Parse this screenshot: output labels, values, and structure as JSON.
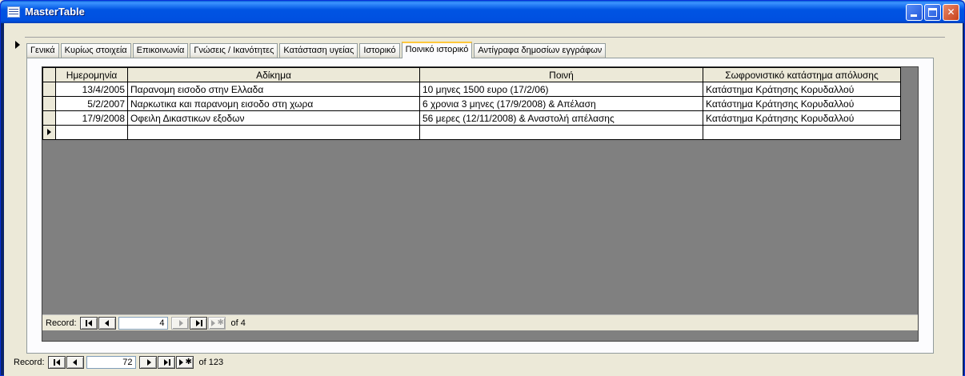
{
  "window": {
    "title": "MasterTable"
  },
  "tabs": [
    {
      "label": "Γενικά",
      "active": false
    },
    {
      "label": "Κυρίως στοιχεία",
      "active": false
    },
    {
      "label": "Επικοινωνία",
      "active": false
    },
    {
      "label": "Γνώσεις / Ικανότητες",
      "active": false
    },
    {
      "label": "Κατάσταση υγείας",
      "active": false
    },
    {
      "label": "Ιστορικό",
      "active": false
    },
    {
      "label": "Ποινικό ιστορικό",
      "active": true
    },
    {
      "label": "Αντίγραφα δημοσίων εγγράφων",
      "active": false
    }
  ],
  "grid": {
    "columns": [
      "Ημερομηνία",
      "Αδίκημα",
      "Ποινή",
      "Σωφρονιστικό κατάστημα απόλυσης"
    ],
    "rows": [
      [
        "13/4/2005",
        "Παρανομη εισοδο στην Ελλαδα",
        "10 μηνες 1500 ευρο (17/2/06)",
        "Κατάστημα Κράτησης Κορυδαλλού"
      ],
      [
        "5/2/2007",
        "Ναρκωτικα και παρανομη εισοδο στη χωρα",
        "6 χρονια 3 μηνες (17/9/2008) & Απέλαση",
        "Κατάστημα Κράτησης Κορυδαλλού"
      ],
      [
        "17/9/2008",
        "Οφειλη Δικαστικων εξοδων",
        "56 μερες (12/11/2008) & Αναστολή απέλασης",
        "Κατάστημα Κράτησης Κορυδαλλού"
      ],
      [
        "",
        "",
        "",
        ""
      ]
    ]
  },
  "subform_nav": {
    "label": "Record:",
    "current": "4",
    "of_text": "of 4"
  },
  "main_nav": {
    "label": "Record:",
    "current": "72",
    "of_text": "of 123"
  }
}
